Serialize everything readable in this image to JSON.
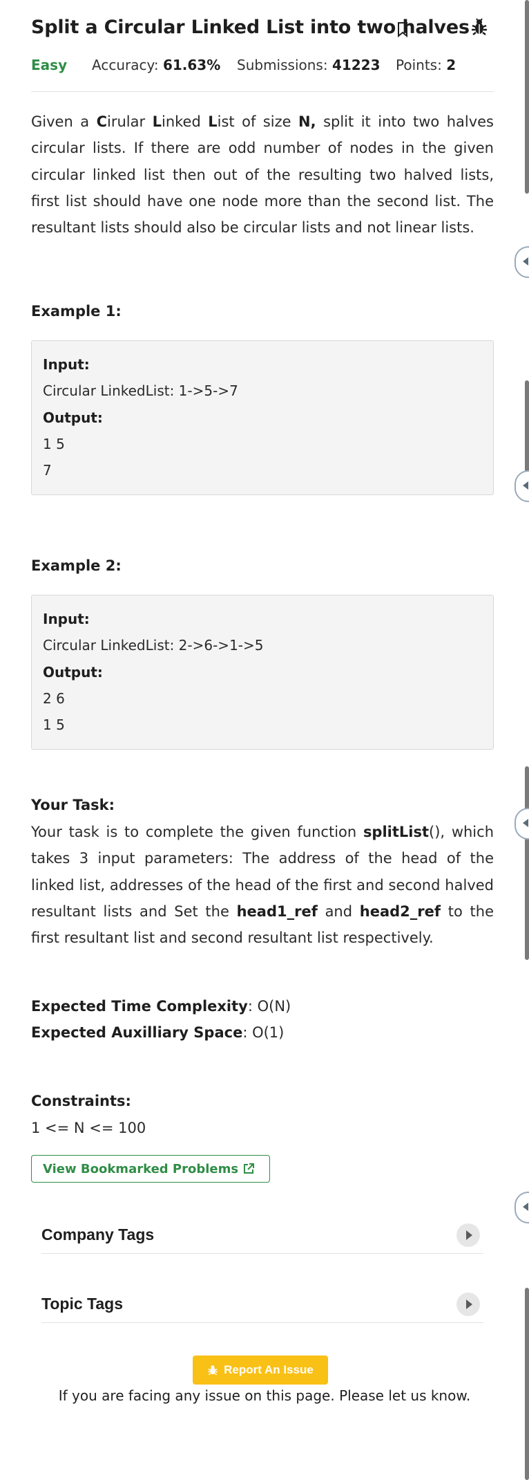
{
  "header": {
    "title": "Split a Circular Linked List into two halves",
    "difficulty": "Easy",
    "accuracy_label": "Accuracy: ",
    "accuracy_value": "61.63%",
    "submissions_label": "Submissions: ",
    "submissions_value": "41223",
    "points_label": "Points: ",
    "points_value": "2"
  },
  "description": {
    "p1": "Given a ",
    "p1_c": "C",
    "p1_mid1": "irular ",
    "p1_l1": "L",
    "p1_mid2": "inked ",
    "p1_l2": "L",
    "p1_mid3": "ist of size ",
    "p1_n": "N,",
    "p1_rest": " split it into two halves circular lists. If there are odd number of nodes in the given circular linked list then out of the resulting two halved lists, first list should have one node more than the second list. The resultant lists should also be circular lists and not linear lists."
  },
  "example1": {
    "heading": "Example 1:",
    "input_label": "Input:",
    "input_value": "Circular LinkedList: 1->5->7",
    "output_label": "Output:",
    "output_line1": "1 5",
    "output_line2": "7"
  },
  "example2": {
    "heading": "Example 2:",
    "input_label": "Input:",
    "input_value": "Circular LinkedList: 2->6->1->5",
    "output_label": "Output:",
    "output_line1": "2 6",
    "output_line2": "1 5"
  },
  "task": {
    "heading": "Your Task:",
    "t1": "Your task is to complete the given function ",
    "fn": "splitList",
    "t2": "(), which takes 3 input parameters: The address of the head of the linked list, addresses of the head of the first and second halved resultant lists and Set the ",
    "h1": "head1_ref",
    "t3": " and ",
    "h2": "head2_ref",
    "t4": " to the first resultant list and second resultant list respectively."
  },
  "complexity": {
    "time_label": "Expected Time Complexity",
    "time_value": ": O(N)",
    "space_label": "Expected Auxilliary Space",
    "space_value": ": O(1)"
  },
  "constraints": {
    "heading": "Constraints:",
    "value": "1 <= N <= 100"
  },
  "buttons": {
    "bookmarked": "View Bookmarked Problems",
    "report": "Report An Issue",
    "report_note": "If you are facing any issue on this page. Please let us know."
  },
  "accordions": {
    "company": "Company Tags",
    "topic": "Topic Tags"
  },
  "colors": {
    "accent_green": "#2f8d46",
    "report_yellow": "#f9c015"
  }
}
